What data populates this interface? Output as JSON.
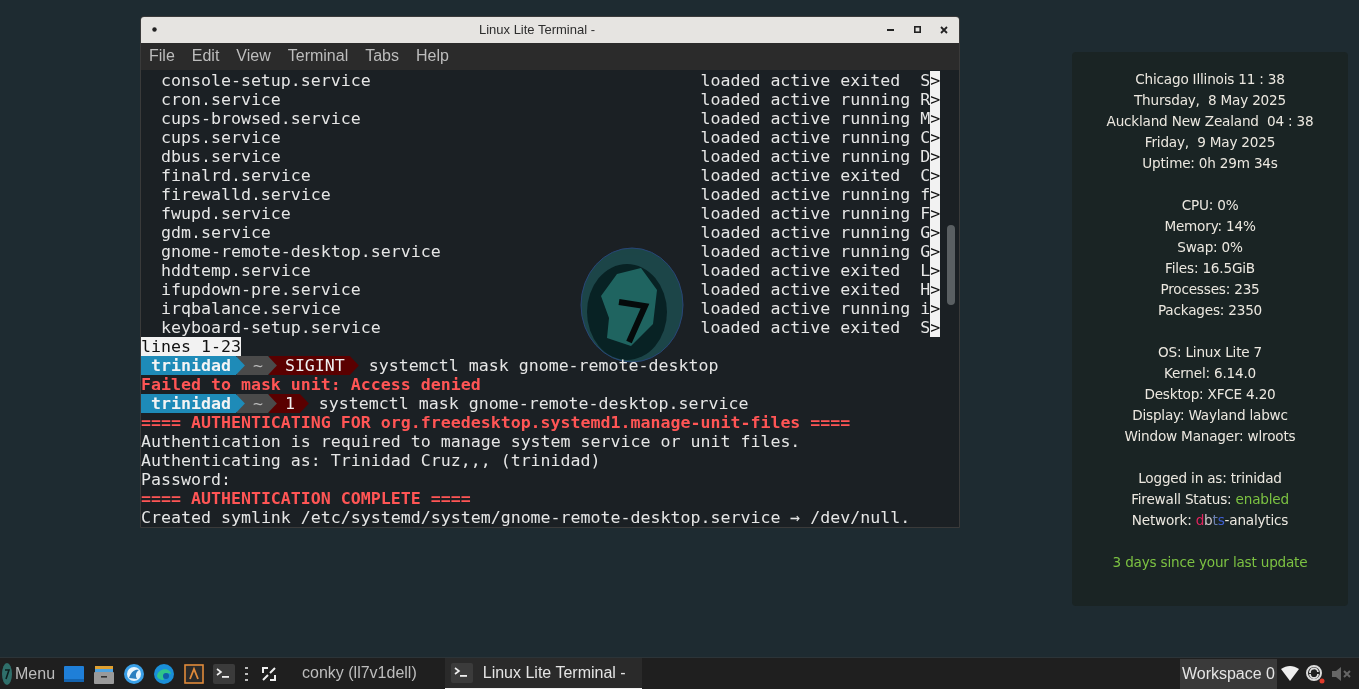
{
  "window": {
    "title": "Linux Lite Terminal -"
  },
  "menu": [
    "File",
    "Edit",
    "View",
    "Terminal",
    "Tabs",
    "Help"
  ],
  "terminal": {
    "lines": [
      {
        "kind": "service",
        "unit": "console-setup.service",
        "load": "loaded",
        "active": "active",
        "sub": "exited",
        "description": "S",
        "more": ">"
      },
      {
        "kind": "service",
        "unit": "cron.service",
        "load": "loaded",
        "active": "active",
        "sub": "running",
        "description": "R",
        "more": ">"
      },
      {
        "kind": "service",
        "unit": "cups-browsed.service",
        "load": "loaded",
        "active": "active",
        "sub": "running",
        "description": "M",
        "more": ">"
      },
      {
        "kind": "service",
        "unit": "cups.service",
        "load": "loaded",
        "active": "active",
        "sub": "running",
        "description": "C",
        "more": ">"
      },
      {
        "kind": "service",
        "unit": "dbus.service",
        "load": "loaded",
        "active": "active",
        "sub": "running",
        "description": "D",
        "more": ">"
      },
      {
        "kind": "service",
        "unit": "finalrd.service",
        "load": "loaded",
        "active": "active",
        "sub": "exited",
        "description": "C",
        "more": ">"
      },
      {
        "kind": "service",
        "unit": "firewalld.service",
        "load": "loaded",
        "active": "active",
        "sub": "running",
        "description": "f",
        "more": ">"
      },
      {
        "kind": "service",
        "unit": "fwupd.service",
        "load": "loaded",
        "active": "active",
        "sub": "running",
        "description": "F",
        "more": ">"
      },
      {
        "kind": "service",
        "unit": "gdm.service",
        "load": "loaded",
        "active": "active",
        "sub": "running",
        "description": "G",
        "more": ">"
      },
      {
        "kind": "service",
        "unit": "gnome-remote-desktop.service",
        "load": "loaded",
        "active": "active",
        "sub": "running",
        "description": "G",
        "more": ">"
      },
      {
        "kind": "service",
        "unit": "hddtemp.service",
        "load": "loaded",
        "active": "active",
        "sub": "exited",
        "description": "L",
        "more": ">"
      },
      {
        "kind": "service",
        "unit": "ifupdown-pre.service",
        "load": "loaded",
        "active": "active",
        "sub": "exited",
        "description": "H",
        "more": ">"
      },
      {
        "kind": "service",
        "unit": "irqbalance.service",
        "load": "loaded",
        "active": "active",
        "sub": "running",
        "description": "i",
        "more": ">"
      },
      {
        "kind": "service",
        "unit": "keyboard-setup.service",
        "load": "loaded",
        "active": "active",
        "sub": "exited",
        "description": "S",
        "more": ">"
      },
      {
        "kind": "pager",
        "text": "lines 1-23"
      },
      {
        "kind": "prompt",
        "user": "trinidad",
        "dir": "~",
        "status": "SIGINT",
        "command": "systemctl mask gnome-remote-desktop"
      },
      {
        "kind": "error",
        "text": "Failed to mask unit: Access denied"
      },
      {
        "kind": "prompt",
        "user": "trinidad",
        "dir": "~",
        "status": "1",
        "command": "systemctl mask gnome-remote-desktop.service"
      },
      {
        "kind": "error",
        "text": "==== AUTHENTICATING FOR org.freedesktop.systemd1.manage-unit-files ===="
      },
      {
        "kind": "text",
        "text": "Authentication is required to manage system service or unit files."
      },
      {
        "kind": "text",
        "text": "Authenticating as: Trinidad Cruz,,, (trinidad)"
      },
      {
        "kind": "text",
        "text": "Password:"
      },
      {
        "kind": "error",
        "text": "==== AUTHENTICATION COMPLETE ===="
      },
      {
        "kind": "text",
        "text": "Created symlink /etc/systemd/system/gnome-remote-desktop.service → /dev/null."
      }
    ]
  },
  "conky": {
    "groups": [
      [
        {
          "parts": [
            {
              "text": "Chicago Illinois 11 : 38"
            }
          ]
        },
        {
          "parts": [
            {
              "text": "Thursday,  8 May 2025"
            }
          ]
        },
        {
          "parts": [
            {
              "text": "Auckland New Zealand  04 : 38"
            }
          ]
        },
        {
          "parts": [
            {
              "text": "Friday,  9 May 2025"
            }
          ]
        },
        {
          "parts": [
            {
              "text": "Uptime: 0h 29m 34s"
            }
          ]
        }
      ],
      [
        {
          "parts": [
            {
              "text": "CPU: 0%"
            }
          ]
        },
        {
          "parts": [
            {
              "text": "Memory: 14%"
            }
          ]
        },
        {
          "parts": [
            {
              "text": "Swap: 0%"
            }
          ]
        },
        {
          "parts": [
            {
              "text": "Files: 16.5GiB"
            }
          ]
        },
        {
          "parts": [
            {
              "text": "Processes: 235"
            }
          ]
        },
        {
          "parts": [
            {
              "text": "Packages: 2350"
            }
          ]
        }
      ],
      [
        {
          "parts": [
            {
              "text": "OS: Linux Lite 7"
            }
          ]
        },
        {
          "parts": [
            {
              "text": "Kernel: 6.14.0"
            }
          ]
        },
        {
          "parts": [
            {
              "text": "Desktop: XFCE 4.20"
            }
          ]
        },
        {
          "parts": [
            {
              "text": "Display: Wayland labwc"
            }
          ]
        },
        {
          "parts": [
            {
              "text": "Window Manager: wlroots"
            }
          ]
        }
      ],
      [
        {
          "parts": [
            {
              "text": "Logged in as: trinidad"
            }
          ]
        },
        {
          "parts": [
            {
              "text": "Firewall Status: "
            },
            {
              "text": "enabled",
              "color": "#7cc242"
            }
          ]
        },
        {
          "parts": [
            {
              "text": "Network: "
            },
            {
              "text": "d",
              "color": "#e0245e"
            },
            {
              "text": "b",
              "color": "#d0c8cc"
            },
            {
              "text": "t",
              "color": "#6a7fb0"
            },
            {
              "text": "s",
              "color": "#3f5fd0"
            },
            {
              "text": "-analytics"
            }
          ]
        }
      ],
      [
        {
          "parts": [
            {
              "text": "3 days since your last update",
              "color": "#7cc242"
            }
          ]
        }
      ]
    ]
  },
  "taskbar": {
    "menu_label": "Menu",
    "tasks": [
      {
        "label": "conky (ll7v1dell)",
        "selected": false
      },
      {
        "label": "Linux Lite Terminal -",
        "selected": true
      }
    ],
    "workspace": "Workspace 0"
  }
}
